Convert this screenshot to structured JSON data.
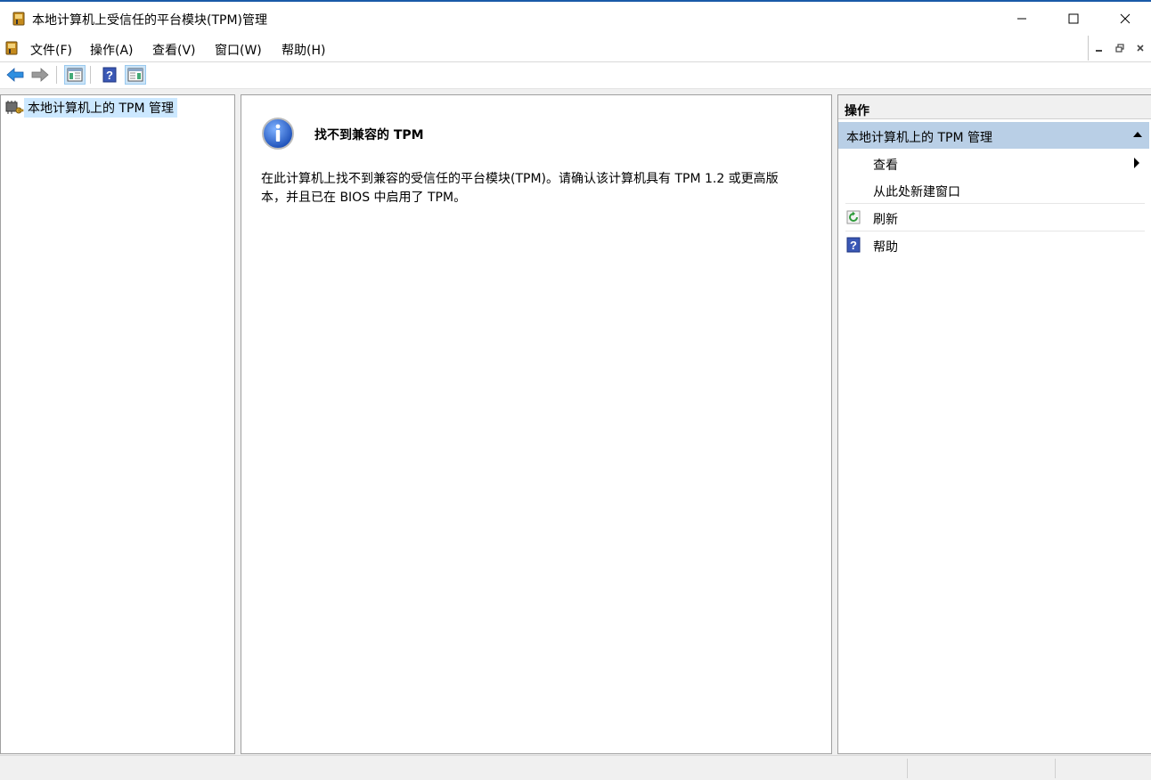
{
  "window": {
    "title": "本地计算机上受信任的平台模块(TPM)管理",
    "icon": "tpm-console-icon",
    "controls": [
      "minimize-icon",
      "maximize-icon",
      "close-icon"
    ]
  },
  "menubar": {
    "items": [
      {
        "label": "文件(F)"
      },
      {
        "label": "操作(A)"
      },
      {
        "label": "查看(V)"
      },
      {
        "label": "窗口(W)"
      },
      {
        "label": "帮助(H)"
      }
    ],
    "mdi_controls": [
      "child-minimize-icon",
      "child-restore-icon",
      "child-close-icon"
    ]
  },
  "toolbar": {
    "buttons": [
      "back-arrow-icon",
      "forward-arrow-icon",
      "show-hide-tree-icon",
      "help-icon",
      "show-hide-action-pane-icon"
    ]
  },
  "tree": {
    "root_label": "本地计算机上的 TPM 管理",
    "root_icon": "tpm-chip-icon"
  },
  "main": {
    "message_title": "找不到兼容的 TPM",
    "message_body": "在此计算机上找不到兼容的受信任的平台模块(TPM)。请确认该计算机具有 TPM 1.2 或更高版本，并且已在 BIOS 中启用了 TPM。",
    "icon": "info-icon"
  },
  "actions": {
    "header": "操作",
    "group_label": "本地计算机上的 TPM 管理",
    "items": [
      {
        "label": "查看",
        "icon": "",
        "has_submenu": true
      },
      {
        "label": "从此处新建窗口",
        "icon": "",
        "has_submenu": false
      },
      {
        "label": "刷新",
        "icon": "refresh-icon",
        "has_submenu": false
      },
      {
        "label": "帮助",
        "icon": "help-icon",
        "has_submenu": false
      }
    ]
  },
  "colors": {
    "accent": "#1a5aa8",
    "selection": "#cce8ff",
    "action_group_bg": "#b9cfe6"
  }
}
